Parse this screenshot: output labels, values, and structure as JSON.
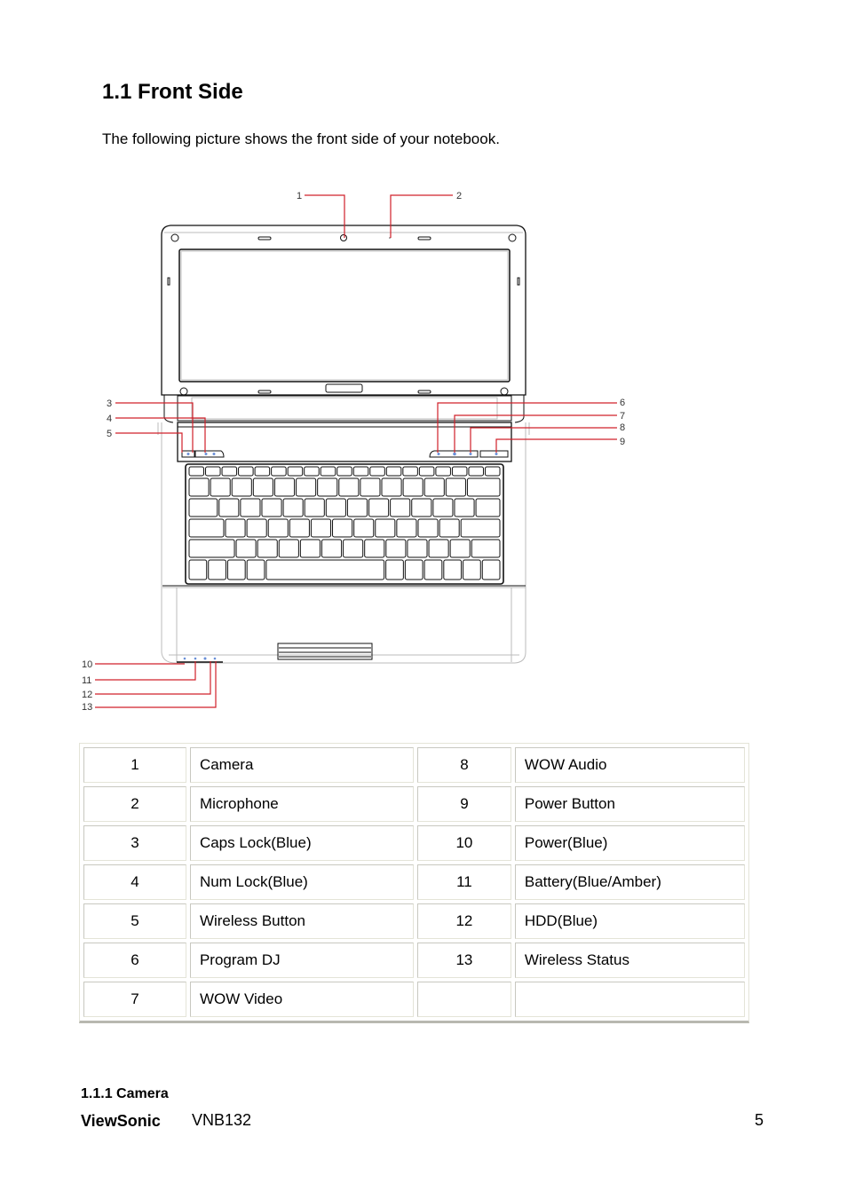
{
  "section": {
    "title": "1.1 Front Side",
    "intro": "The following picture shows the front side of your notebook."
  },
  "diagram": {
    "callouts": [
      "1",
      "2",
      "3",
      "4",
      "5",
      "6",
      "7",
      "8",
      "9",
      "10",
      "11",
      "12",
      "13"
    ],
    "leader_color": "#d0202a",
    "led_color": "#6a8fd8"
  },
  "parts_table": {
    "rows": [
      {
        "n1": "1",
        "d1": "Camera",
        "n2": "8",
        "d2": "WOW Audio"
      },
      {
        "n1": "2",
        "d1": "Microphone",
        "n2": "9",
        "d2": "Power Button"
      },
      {
        "n1": "3",
        "d1": "Caps Lock(Blue)",
        "n2": "10",
        "d2": "Power(Blue)"
      },
      {
        "n1": "4",
        "d1": "Num Lock(Blue)",
        "n2": "11",
        "d2": "Battery(Blue/Amber)"
      },
      {
        "n1": "5",
        "d1": "Wireless Button",
        "n2": "12",
        "d2": "HDD(Blue)"
      },
      {
        "n1": "6",
        "d1": "Program DJ",
        "n2": "13",
        "d2": "Wireless Status"
      },
      {
        "n1": "7",
        "d1": "WOW Video",
        "n2": "",
        "d2": ""
      }
    ]
  },
  "subsection": {
    "title": "1.1.1 Camera"
  },
  "footer": {
    "brand": "ViewSonic",
    "model": "VNB132",
    "page": "5"
  }
}
